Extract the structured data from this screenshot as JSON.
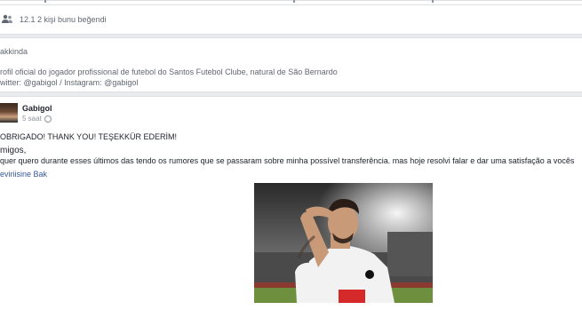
{
  "likes": {
    "text": "12.1 2 kişi bunu beğendi"
  },
  "about": {
    "title": "akkinda",
    "description": "rofil oficial do jogador profissional de futebol do Santos Futebol Clube, natural de São Bernardo",
    "social": "witter: @gabigol / Instagram: @gabigol"
  },
  "post": {
    "author": "Gabigol",
    "time": "5 saat",
    "line1": "OBRIGADO! THANK YOU! TEŞEKKÜR EDERİM!",
    "line2": "migos,",
    "line3": "quer quero durante esses últimos das tendo os rumores que se passaram sobre minha possível transferência. mas hoje resolvi falar e dar uma satisfação a vocês",
    "see_translation": "eviriisine Bak"
  },
  "colors": {
    "background": "#e9ebee",
    "card": "#ffffff",
    "link": "#385898",
    "meta": "#90949c"
  },
  "icons": [
    "people-icon",
    "globe-icon"
  ]
}
